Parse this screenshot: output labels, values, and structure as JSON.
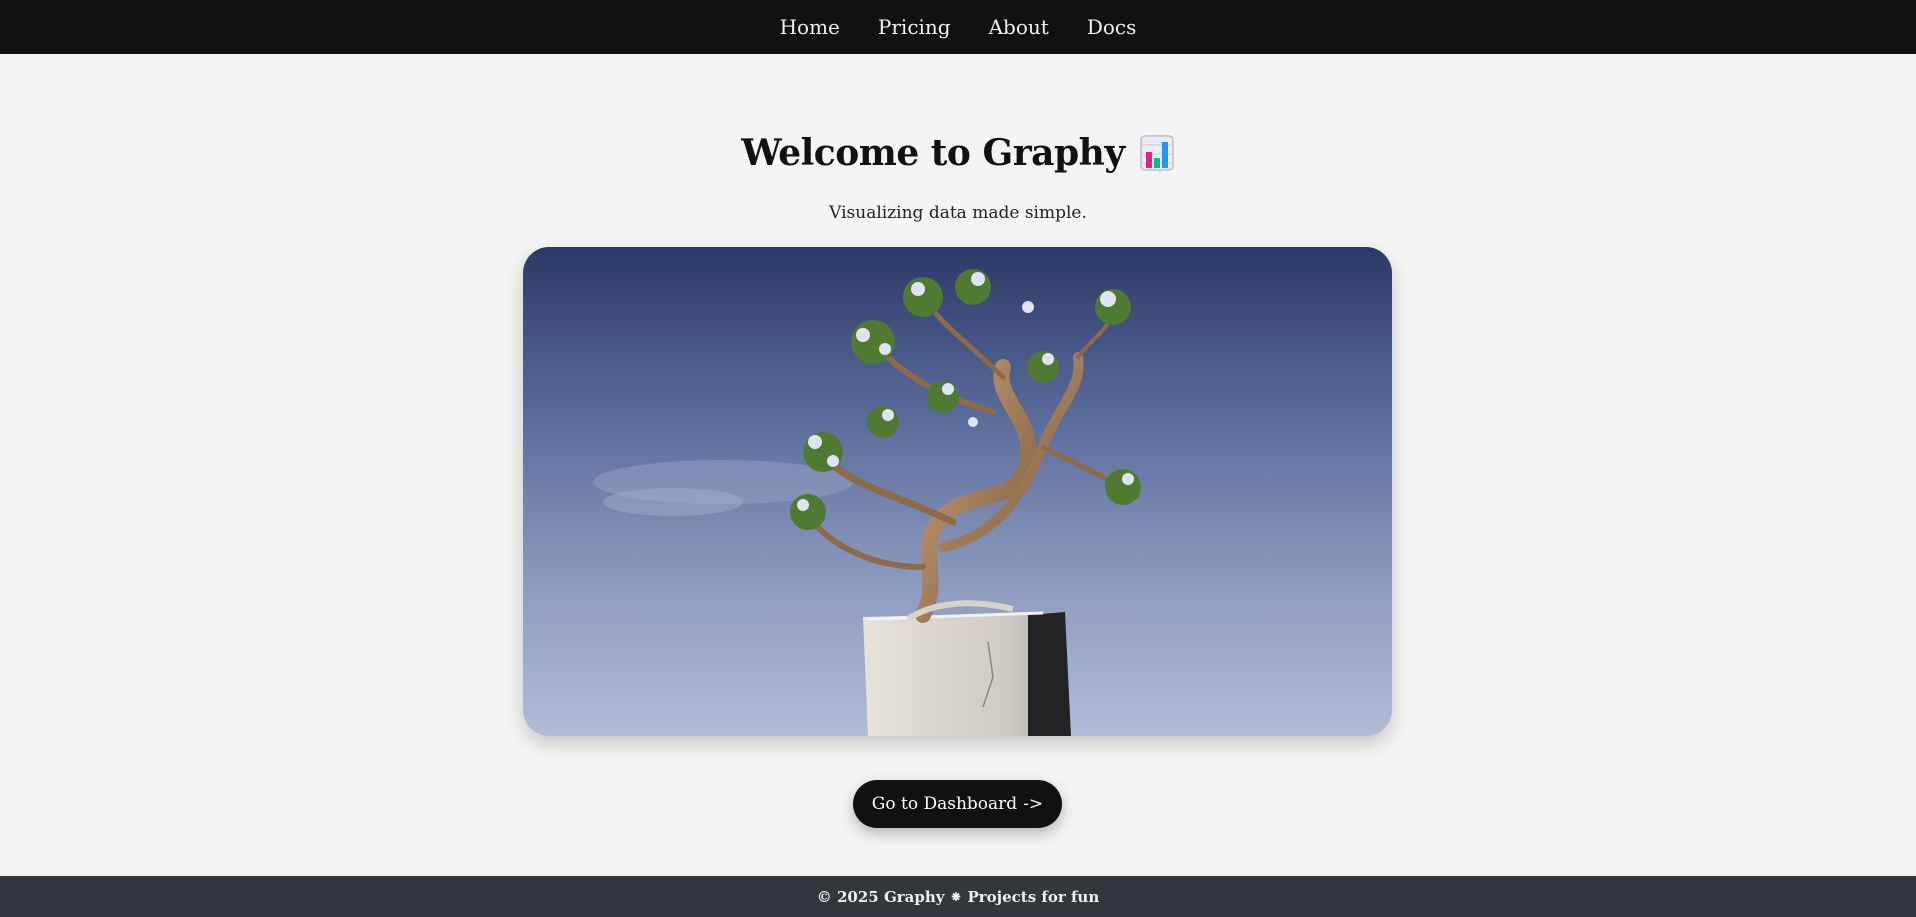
{
  "nav": {
    "items": [
      {
        "label": "Home"
      },
      {
        "label": "Pricing"
      },
      {
        "label": "About"
      },
      {
        "label": "Docs"
      }
    ]
  },
  "hero": {
    "title": "Welcome to Graphy",
    "title_icon": "bar-chart-icon",
    "subtitle": "Visualizing data made simple.",
    "image_description_icon": "bonsai-tree-image"
  },
  "cta": {
    "label": "Go to Dashboard",
    "arrow": "->"
  },
  "footer": {
    "text": "© 2025 Graphy ⁕ Projects for fun"
  },
  "colors": {
    "nav_bg": "#111111",
    "page_bg": "#f4f4f4",
    "button_bg": "#111111",
    "footer_bg": "#33363d"
  }
}
